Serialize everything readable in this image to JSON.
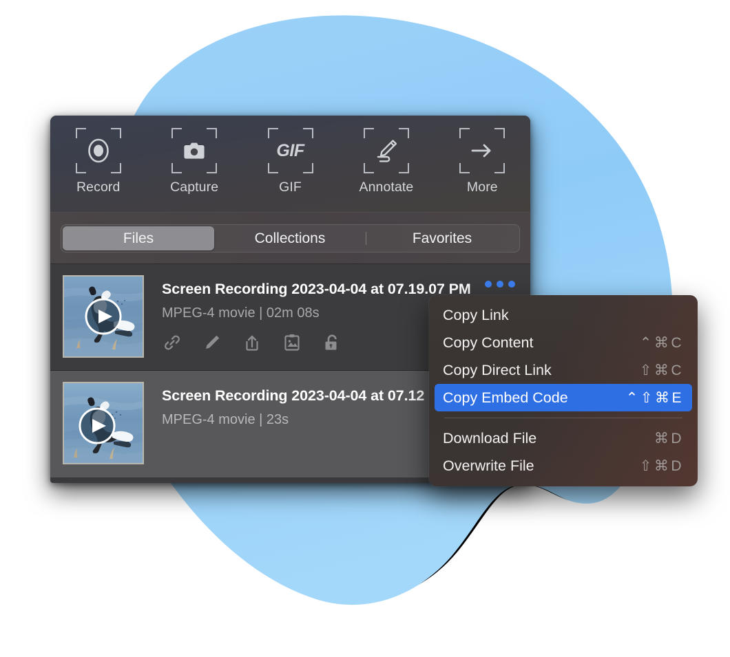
{
  "theme": {
    "blob_fill": "#8FCBF7",
    "blob_outline": "#000000",
    "panel_bg": "#3c3c3e",
    "row_hover_bg": "#58585b",
    "accent_blue": "#2f6fe4",
    "dots_blue": "#3d7ff0",
    "tab_active_bg": "#8e8e92"
  },
  "toolbar": {
    "items": [
      {
        "label": "Record",
        "icon": "record-icon"
      },
      {
        "label": "Capture",
        "icon": "camera-icon"
      },
      {
        "label": "GIF",
        "icon": "gif-icon",
        "glyph": "GIF"
      },
      {
        "label": "Annotate",
        "icon": "pencil-annotate-icon"
      },
      {
        "label": "More",
        "icon": "arrow-right-icon"
      }
    ]
  },
  "tabs": {
    "items": [
      {
        "label": "Files",
        "active": true
      },
      {
        "label": "Collections",
        "active": false
      },
      {
        "label": "Favorites",
        "active": false
      }
    ]
  },
  "files": [
    {
      "title": "Screen Recording 2023-04-04 at 07.19.07 PM",
      "subtitle": "MPEG-4 movie | 02m 08s",
      "thumbnail_alt": "dog splashing in blue water",
      "play_overlay": true,
      "actions": [
        {
          "name": "copy-link-icon",
          "label": "Copy Link"
        },
        {
          "name": "annotate-icon",
          "label": "Annotate"
        },
        {
          "name": "share-icon",
          "label": "Share"
        },
        {
          "name": "save-image-icon",
          "label": "Save to Clipboard"
        },
        {
          "name": "unlock-icon",
          "label": "Unlocked"
        }
      ],
      "more_button": "•••"
    },
    {
      "title": "Screen Recording 2023-04-04 at 07.12",
      "subtitle": "MPEG-4 movie | 23s",
      "thumbnail_alt": "dog splashing in blue water",
      "play_overlay": true,
      "actions": [],
      "more_button": ""
    }
  ],
  "context_menu": {
    "items": [
      {
        "label": "Copy Link",
        "shortcut": "",
        "selected": false,
        "separator_after": false
      },
      {
        "label": "Copy Content",
        "shortcut": "⌃⌘C",
        "selected": false,
        "separator_after": false
      },
      {
        "label": "Copy Direct Link",
        "shortcut": "⇧⌘C",
        "selected": false,
        "separator_after": false
      },
      {
        "label": "Copy Embed Code",
        "shortcut": "⌃⇧⌘E",
        "selected": true,
        "separator_after": true
      },
      {
        "label": "Download File",
        "shortcut": "⌘D",
        "selected": false,
        "separator_after": false
      },
      {
        "label": "Overwrite File",
        "shortcut": "⇧⌘D",
        "selected": false,
        "separator_after": false
      }
    ]
  }
}
